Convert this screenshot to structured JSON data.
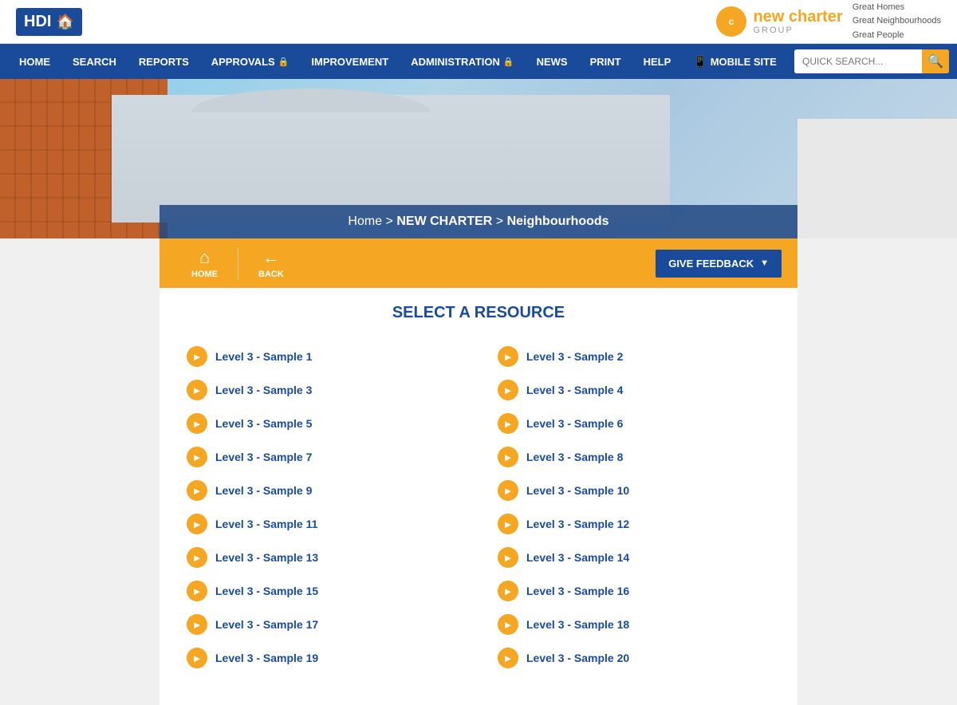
{
  "header": {
    "hdi_label": "HDI",
    "brand_name_new": "new charter",
    "brand_name_group": "GROUP",
    "taglines": [
      "Great Homes",
      "Great Neighbourhoods",
      "Great People"
    ],
    "quick_search_placeholder": "QUICK SEARCH..."
  },
  "nav": {
    "items": [
      {
        "label": "HOME",
        "has_lock": false,
        "has_mobile_icon": false
      },
      {
        "label": "SEARCH",
        "has_lock": false,
        "has_mobile_icon": false
      },
      {
        "label": "REPORTS",
        "has_lock": false,
        "has_mobile_icon": false
      },
      {
        "label": "APPROVALS",
        "has_lock": true,
        "has_mobile_icon": false
      },
      {
        "label": "IMPROVEMENT",
        "has_lock": false,
        "has_mobile_icon": false
      },
      {
        "label": "ADMINISTRATION",
        "has_lock": true,
        "has_mobile_icon": false
      },
      {
        "label": "NEWS",
        "has_lock": false,
        "has_mobile_icon": false
      },
      {
        "label": "PRINT",
        "has_lock": false,
        "has_mobile_icon": false
      },
      {
        "label": "HELP",
        "has_lock": false,
        "has_mobile_icon": false
      },
      {
        "label": "MOBILE SITE",
        "has_lock": false,
        "has_mobile_icon": true
      }
    ]
  },
  "breadcrumb": {
    "text": "Home > NEW CHARTER > Neighbourhoods"
  },
  "action_bar": {
    "home_label": "HOME",
    "back_label": "BACK",
    "feedback_label": "GIVE FEEDBACK"
  },
  "main": {
    "title": "SELECT A RESOURCE",
    "resources": [
      "Level 3 - Sample 1",
      "Level 3 - Sample 2",
      "Level 3 - Sample 3",
      "Level 3 - Sample 4",
      "Level 3 - Sample 5",
      "Level 3 - Sample 6",
      "Level 3 - Sample 7",
      "Level 3 - Sample 8",
      "Level 3 - Sample 9",
      "Level 3 - Sample 10",
      "Level 3 - Sample 11",
      "Level 3 - Sample 12",
      "Level 3 - Sample 13",
      "Level 3 - Sample 14",
      "Level 3 - Sample 15",
      "Level 3 - Sample 16",
      "Level 3 - Sample 17",
      "Level 3 - Sample 18",
      "Level 3 - Sample 19",
      "Level 3 - Sample 20"
    ]
  }
}
